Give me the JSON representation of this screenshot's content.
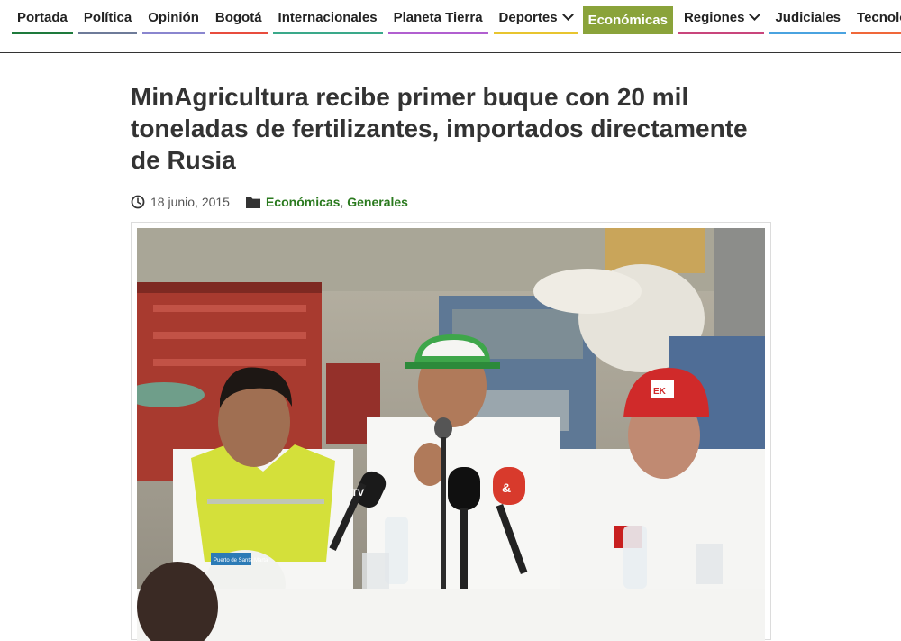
{
  "nav": {
    "items": [
      {
        "label": "Portada",
        "color": "#1e7a3c",
        "has_dropdown": false
      },
      {
        "label": "Política",
        "color": "#6e7b99",
        "has_dropdown": false
      },
      {
        "label": "Opinión",
        "color": "#8a86cf",
        "has_dropdown": false
      },
      {
        "label": "Bogotá",
        "color": "#e84c3d",
        "has_dropdown": false
      },
      {
        "label": "Internacionales",
        "color": "#3aa98a",
        "has_dropdown": false
      },
      {
        "label": "Planeta Tierra",
        "color": "#b15fd0",
        "has_dropdown": false
      },
      {
        "label": "Deportes",
        "color": "#e8c52f",
        "has_dropdown": true
      },
      {
        "label": "Económicas",
        "color": "#8aa33a",
        "has_dropdown": false,
        "active": true
      },
      {
        "label": "Regiones",
        "color": "#c9457c",
        "has_dropdown": true
      },
      {
        "label": "Judiciales",
        "color": "#4aa3e0",
        "has_dropdown": false
      },
      {
        "label": "Tecnología",
        "color": "#f0683a",
        "has_dropdown": false
      }
    ]
  },
  "article": {
    "title": "MinAgricultura recibe primer buque con 20 mil toneladas de fertilizantes, importados directamente de Rusia",
    "date": "18 junio, 2015",
    "categories": [
      "Económicas",
      "Generales"
    ],
    "category_separator": ",",
    "date_icon": "clock-icon",
    "category_icon": "folder-icon",
    "link_color": "#2a7a1e"
  },
  "photo": {
    "microphone_label_tv": "TV",
    "microphone_label_amp": "&",
    "cap_logo": "EK",
    "vest_text": "Puerto de Santa Marta"
  }
}
